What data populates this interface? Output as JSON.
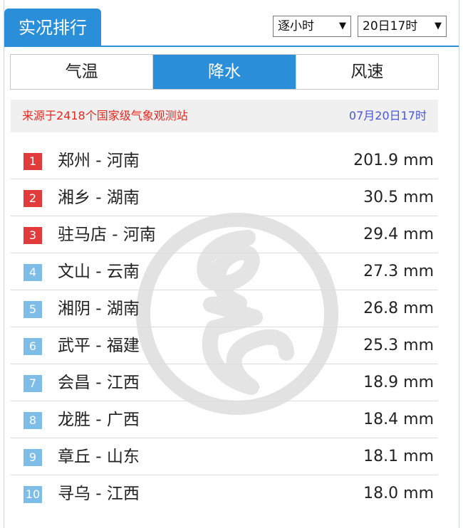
{
  "header": {
    "title": "实况排行",
    "mode_select": "逐小时",
    "time_select": "20日17时"
  },
  "tabs": [
    {
      "label": "气温",
      "active": false
    },
    {
      "label": "降水",
      "active": true
    },
    {
      "label": "风速",
      "active": false
    }
  ],
  "source": {
    "text": "来源于2418个国家级气象观测站",
    "time": "07月20日17时"
  },
  "ranking": [
    {
      "rank": "1",
      "place": "郑州 - 河南",
      "value": "201.9 mm"
    },
    {
      "rank": "2",
      "place": "湘乡 - 湖南",
      "value": "30.5 mm"
    },
    {
      "rank": "3",
      "place": "驻马店 - 河南",
      "value": "29.4 mm"
    },
    {
      "rank": "4",
      "place": "文山 - 云南",
      "value": "27.3 mm"
    },
    {
      "rank": "5",
      "place": "湘阴 - 湖南",
      "value": "26.8 mm"
    },
    {
      "rank": "6",
      "place": "武平 - 福建",
      "value": "25.3 mm"
    },
    {
      "rank": "7",
      "place": "会昌 - 江西",
      "value": "18.9 mm"
    },
    {
      "rank": "8",
      "place": "龙胜 - 广西",
      "value": "18.4 mm"
    },
    {
      "rank": "9",
      "place": "章丘 - 山东",
      "value": "18.1 mm"
    },
    {
      "rank": "10",
      "place": "寻乌 - 江西",
      "value": "18.0 mm"
    }
  ],
  "colors": {
    "accent": "#2a8fd8",
    "top_rank": "#e23b3b",
    "rank": "#7dbde8",
    "source_text": "#e8271e",
    "source_time": "#4a55d8"
  },
  "watermark_icon": "weather-logo-watermark"
}
